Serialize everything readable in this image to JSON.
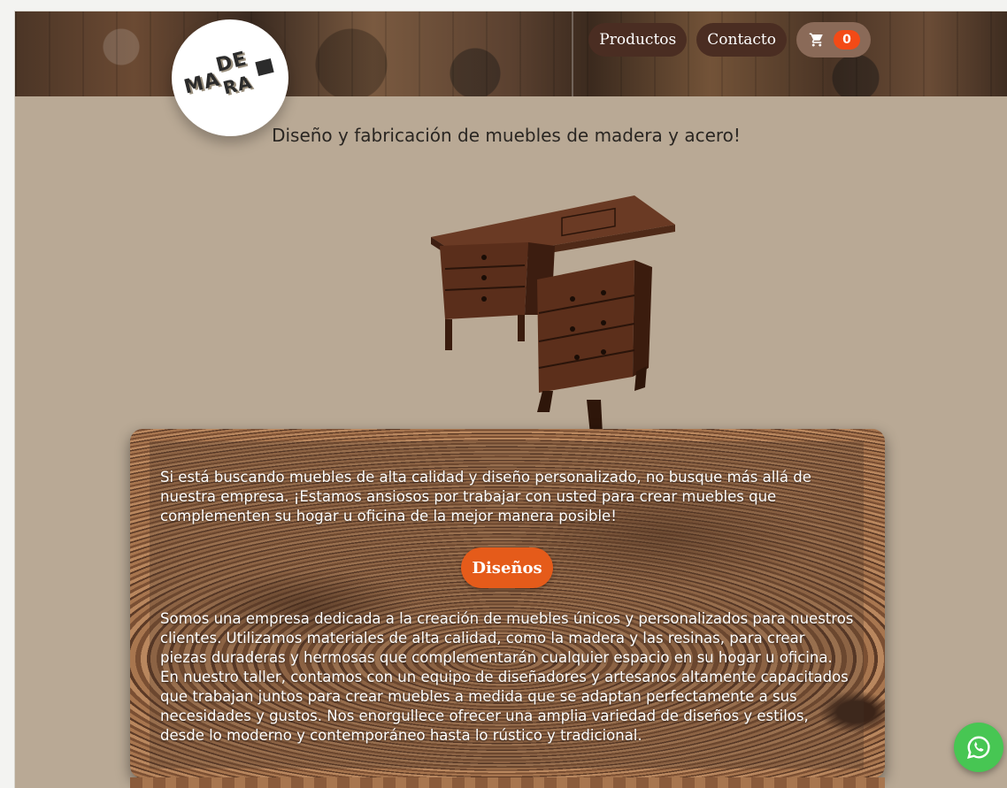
{
  "brand": {
    "logo_lines": [
      "DE",
      "MA",
      "RA"
    ]
  },
  "nav": {
    "items": [
      {
        "label": "Productos"
      },
      {
        "label": "Contacto"
      }
    ],
    "cart": {
      "icon": "cart-icon",
      "count": "0"
    }
  },
  "hero": {
    "tagline": "Diseño y fabricación de muebles de madera y acero!"
  },
  "content": {
    "intro": "Si está buscando muebles de alta calidad y diseño personalizado, no busque más allá de nuestra empresa. ¡Estamos ansiosos por trabajar con usted para crear muebles que complementen su hogar u oficina de la mejor manera posible!",
    "button_label": "Diseños",
    "description": "Somos una empresa dedicada a la creación de muebles únicos y personalizados para nuestros clientes. Utilizamos materiales de alta calidad, como la madera y las resinas, para crear piezas duraderas y hermosas que complementarán cualquier espacio en su hogar u oficina. En nuestro taller, contamos con un equipo de diseñadores y artesanos altamente capacitados que trabajan juntos para crear muebles a medida que se adaptan perfectamente a sus necesidades y gustos. Nos enorgullece ofrecer una amplia variedad de diseños y estilos, desde lo moderno y contemporáneo hasta lo rústico y tradicional."
  },
  "floating": {
    "icon": "whatsapp-icon"
  },
  "colors": {
    "background": "#b9a995",
    "nav_button": "#4a2d22",
    "cart_badge": "#f34a16",
    "accent_button": "#e55b1a",
    "whatsapp": "#47c653"
  }
}
